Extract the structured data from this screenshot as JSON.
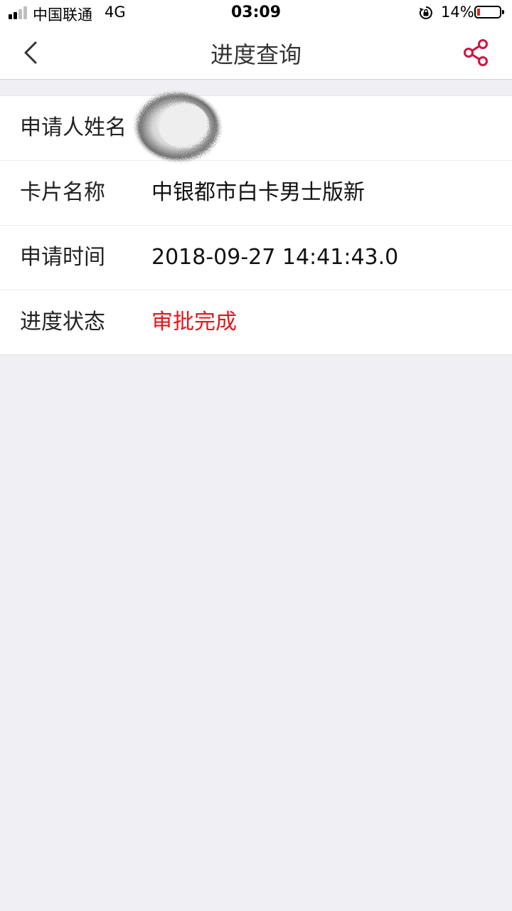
{
  "status_bar": {
    "carrier": "中国联通",
    "network": "4G",
    "time": "03:09",
    "battery_percent": "14%",
    "battery_level": 0.14,
    "battery_color": "#e3261e",
    "signal_bars_filled": 2,
    "signal_bars_total": 4
  },
  "nav": {
    "title": "进度查询",
    "back_icon": "chevron-left-icon",
    "share_icon": "share-icon",
    "accent_color": "#d0143e"
  },
  "details": [
    {
      "label": "申请人姓名",
      "value": ""
    },
    {
      "label": "卡片名称",
      "value": "中银都市白卡男士版新"
    },
    {
      "label": "申请时间",
      "value": "2018-09-27 14:41:43.0"
    },
    {
      "label": "进度状态",
      "value": "审批完成",
      "color": "#e0181e"
    }
  ]
}
